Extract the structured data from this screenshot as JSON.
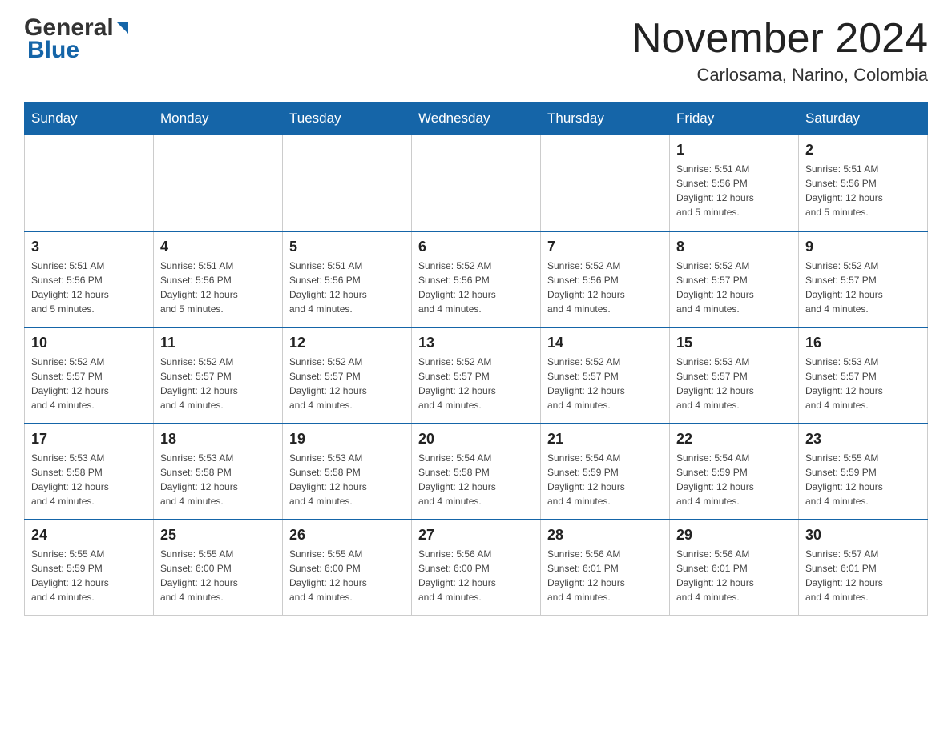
{
  "header": {
    "logo_general": "General",
    "logo_blue": "Blue",
    "title": "November 2024",
    "subtitle": "Carlosama, Narino, Colombia"
  },
  "weekdays": [
    "Sunday",
    "Monday",
    "Tuesday",
    "Wednesday",
    "Thursday",
    "Friday",
    "Saturday"
  ],
  "weeks": [
    [
      {
        "day": "",
        "info": ""
      },
      {
        "day": "",
        "info": ""
      },
      {
        "day": "",
        "info": ""
      },
      {
        "day": "",
        "info": ""
      },
      {
        "day": "",
        "info": ""
      },
      {
        "day": "1",
        "info": "Sunrise: 5:51 AM\nSunset: 5:56 PM\nDaylight: 12 hours\nand 5 minutes."
      },
      {
        "day": "2",
        "info": "Sunrise: 5:51 AM\nSunset: 5:56 PM\nDaylight: 12 hours\nand 5 minutes."
      }
    ],
    [
      {
        "day": "3",
        "info": "Sunrise: 5:51 AM\nSunset: 5:56 PM\nDaylight: 12 hours\nand 5 minutes."
      },
      {
        "day": "4",
        "info": "Sunrise: 5:51 AM\nSunset: 5:56 PM\nDaylight: 12 hours\nand 5 minutes."
      },
      {
        "day": "5",
        "info": "Sunrise: 5:51 AM\nSunset: 5:56 PM\nDaylight: 12 hours\nand 4 minutes."
      },
      {
        "day": "6",
        "info": "Sunrise: 5:52 AM\nSunset: 5:56 PM\nDaylight: 12 hours\nand 4 minutes."
      },
      {
        "day": "7",
        "info": "Sunrise: 5:52 AM\nSunset: 5:56 PM\nDaylight: 12 hours\nand 4 minutes."
      },
      {
        "day": "8",
        "info": "Sunrise: 5:52 AM\nSunset: 5:57 PM\nDaylight: 12 hours\nand 4 minutes."
      },
      {
        "day": "9",
        "info": "Sunrise: 5:52 AM\nSunset: 5:57 PM\nDaylight: 12 hours\nand 4 minutes."
      }
    ],
    [
      {
        "day": "10",
        "info": "Sunrise: 5:52 AM\nSunset: 5:57 PM\nDaylight: 12 hours\nand 4 minutes."
      },
      {
        "day": "11",
        "info": "Sunrise: 5:52 AM\nSunset: 5:57 PM\nDaylight: 12 hours\nand 4 minutes."
      },
      {
        "day": "12",
        "info": "Sunrise: 5:52 AM\nSunset: 5:57 PM\nDaylight: 12 hours\nand 4 minutes."
      },
      {
        "day": "13",
        "info": "Sunrise: 5:52 AM\nSunset: 5:57 PM\nDaylight: 12 hours\nand 4 minutes."
      },
      {
        "day": "14",
        "info": "Sunrise: 5:52 AM\nSunset: 5:57 PM\nDaylight: 12 hours\nand 4 minutes."
      },
      {
        "day": "15",
        "info": "Sunrise: 5:53 AM\nSunset: 5:57 PM\nDaylight: 12 hours\nand 4 minutes."
      },
      {
        "day": "16",
        "info": "Sunrise: 5:53 AM\nSunset: 5:57 PM\nDaylight: 12 hours\nand 4 minutes."
      }
    ],
    [
      {
        "day": "17",
        "info": "Sunrise: 5:53 AM\nSunset: 5:58 PM\nDaylight: 12 hours\nand 4 minutes."
      },
      {
        "day": "18",
        "info": "Sunrise: 5:53 AM\nSunset: 5:58 PM\nDaylight: 12 hours\nand 4 minutes."
      },
      {
        "day": "19",
        "info": "Sunrise: 5:53 AM\nSunset: 5:58 PM\nDaylight: 12 hours\nand 4 minutes."
      },
      {
        "day": "20",
        "info": "Sunrise: 5:54 AM\nSunset: 5:58 PM\nDaylight: 12 hours\nand 4 minutes."
      },
      {
        "day": "21",
        "info": "Sunrise: 5:54 AM\nSunset: 5:59 PM\nDaylight: 12 hours\nand 4 minutes."
      },
      {
        "day": "22",
        "info": "Sunrise: 5:54 AM\nSunset: 5:59 PM\nDaylight: 12 hours\nand 4 minutes."
      },
      {
        "day": "23",
        "info": "Sunrise: 5:55 AM\nSunset: 5:59 PM\nDaylight: 12 hours\nand 4 minutes."
      }
    ],
    [
      {
        "day": "24",
        "info": "Sunrise: 5:55 AM\nSunset: 5:59 PM\nDaylight: 12 hours\nand 4 minutes."
      },
      {
        "day": "25",
        "info": "Sunrise: 5:55 AM\nSunset: 6:00 PM\nDaylight: 12 hours\nand 4 minutes."
      },
      {
        "day": "26",
        "info": "Sunrise: 5:55 AM\nSunset: 6:00 PM\nDaylight: 12 hours\nand 4 minutes."
      },
      {
        "day": "27",
        "info": "Sunrise: 5:56 AM\nSunset: 6:00 PM\nDaylight: 12 hours\nand 4 minutes."
      },
      {
        "day": "28",
        "info": "Sunrise: 5:56 AM\nSunset: 6:01 PM\nDaylight: 12 hours\nand 4 minutes."
      },
      {
        "day": "29",
        "info": "Sunrise: 5:56 AM\nSunset: 6:01 PM\nDaylight: 12 hours\nand 4 minutes."
      },
      {
        "day": "30",
        "info": "Sunrise: 5:57 AM\nSunset: 6:01 PM\nDaylight: 12 hours\nand 4 minutes."
      }
    ]
  ],
  "colors": {
    "header_bg": "#1565a8",
    "header_text": "#ffffff",
    "border": "#cccccc",
    "day_number": "#222222",
    "day_info": "#444444"
  }
}
